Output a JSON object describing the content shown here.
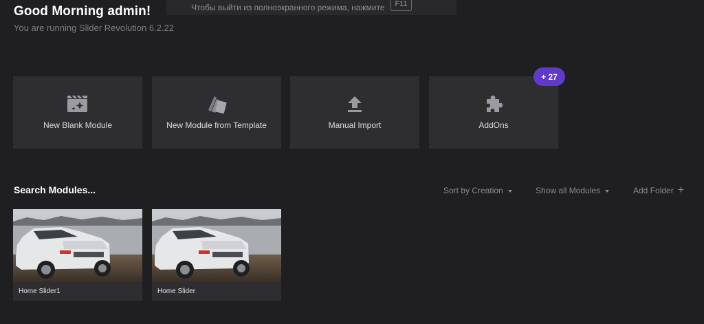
{
  "fullscreen_notice": {
    "text": "Чтобы выйти из полноэкранного режима, нажмите",
    "key": "F11"
  },
  "header": {
    "greeting": "Good Morning admin!",
    "version": "You are running Slider Revolution 6.2.22"
  },
  "actions": [
    {
      "label": "New Blank Module",
      "icon": "film-sparkle-icon"
    },
    {
      "label": "New Module from Template",
      "icon": "template-cards-icon"
    },
    {
      "label": "Manual Import",
      "icon": "upload-icon"
    },
    {
      "label": "AddOns",
      "icon": "puzzle-icon"
    }
  ],
  "addons_badge": "+ 27",
  "modules_toolbar": {
    "search_label": "Search Modules...",
    "sort": "Sort by Creation",
    "filter": "Show all Modules",
    "add_folder": "Add Folder"
  },
  "modules": [
    {
      "name": "Home Slider1",
      "thumb": "white-suv-on-beach"
    },
    {
      "name": "Home Slider",
      "thumb": "white-suv-on-beach"
    }
  ],
  "colors": {
    "background": "#1f1f22",
    "tile": "#2e2e31",
    "badge": "#5f3ac6",
    "icon": "#9a9aa0"
  }
}
